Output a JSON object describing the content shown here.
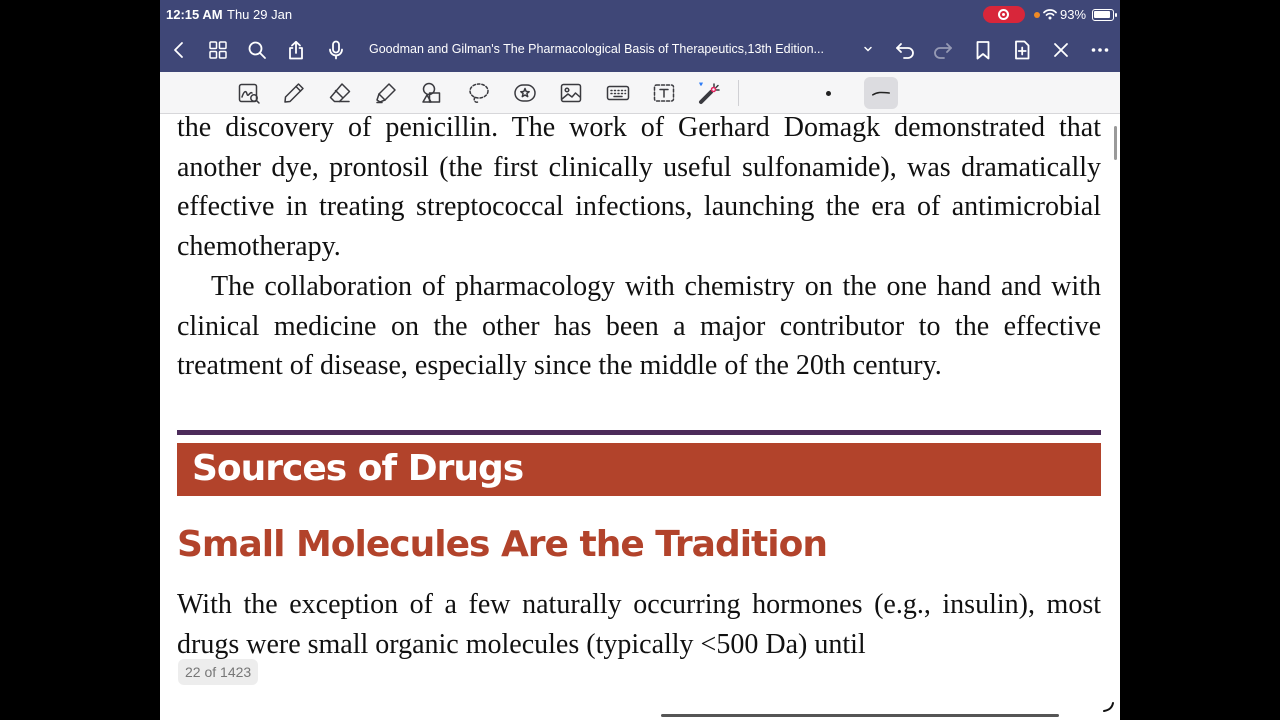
{
  "status_bar": {
    "time": "12:15 AM",
    "date": "Thu 29 Jan",
    "battery": "93%"
  },
  "nav_bar": {
    "document_title": "Goodman and Gilman's The Pharmacological Basis of Therapeutics,13th Edition..."
  },
  "icons": {
    "nav": [
      "back-icon",
      "thumbnails-icon",
      "search-icon",
      "share-icon",
      "microphone-icon",
      "chevron-down-icon",
      "undo-icon",
      "redo-icon",
      "bookmark-icon",
      "add-page-icon",
      "close-icon",
      "more-icon"
    ],
    "tools": [
      "read-mode-icon",
      "pen-icon",
      "eraser-icon",
      "highlighter-icon",
      "shapes-icon",
      "lasso-icon",
      "sticker-icon",
      "image-icon",
      "keyboard-icon",
      "text-box-icon",
      "laser-pointer-icon"
    ]
  },
  "colors": {
    "nav_background": "#3f4777",
    "section_band": "#b2432b",
    "heading_text": "#b2432b",
    "rule": "#4c2b5a",
    "recording": "#d8263a"
  },
  "page": {
    "paragraph_1": "the discovery of penicillin. The work of Gerhard Domagk demonstrated that another dye, prontosil (the first clinically useful sulfonamide), was dramatically effective in treating streptococcal infections, launching the era of antimicrobial chemotherapy.",
    "paragraph_2": "The collaboration of pharmacology with chemistry on the one hand and with clinical medicine on the other has been a major contributor to the effective treatment of disease, especially since the middle of the 20th century.",
    "section_title": "Sources of Drugs",
    "subheading": "Small Molecules Are the Tradition",
    "paragraph_3": "With the exception of a few naturally occurring hormones (e.g., insulin), most drugs were small organic molecules (typically <500 Da) until",
    "page_counter": "22 of 1423"
  }
}
